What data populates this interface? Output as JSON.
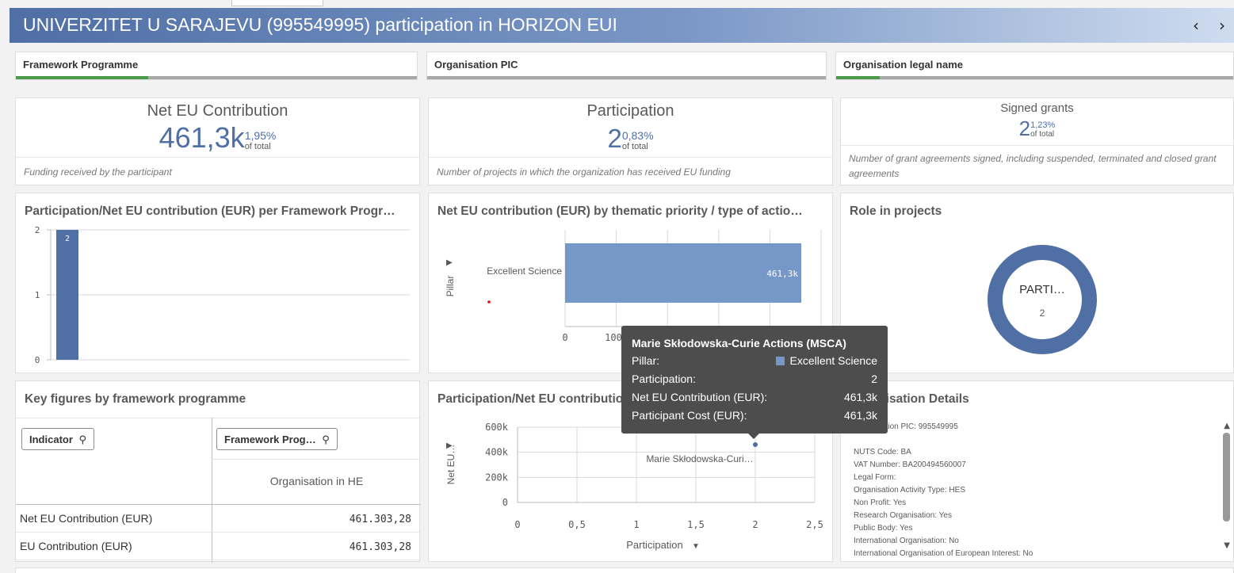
{
  "header": {
    "title": "UNIVERZITET U SARAJEVU (995549995) participation in HORIZON EUI",
    "prev_icon": "chevron-left-icon",
    "next_icon": "chevron-right-icon"
  },
  "filters": [
    {
      "label": "Framework Programme",
      "selected_fraction": 0.33
    },
    {
      "label": "Organisation PIC",
      "selected_fraction": 0
    },
    {
      "label": "Organisation legal name",
      "selected_fraction": 0.11
    }
  ],
  "kpis": {
    "net_eu": {
      "title": "Net EU Contribution",
      "value": "461,3k",
      "pct": "1,95%",
      "of_total": "of total",
      "footer": "Funding received by the participant"
    },
    "participation": {
      "title": "Participation",
      "value": "2",
      "pct": "0,83%",
      "of_total": "of total",
      "footer": "Number of projects in which the organization has received EU funding"
    },
    "signed": {
      "title": "Signed grants",
      "value": "2",
      "pct": "1,23%",
      "of_total": "of total",
      "footer": "Number of grant agreements signed, including suspended, terminated and closed grant agreements"
    }
  },
  "charts": {
    "fp_bar": {
      "title": "Participation/Net EU contribution (EUR) per Framework Progr…"
    },
    "thematic": {
      "title": "Net EU contribution (EUR) by thematic priority / type of actio…",
      "y_axis_label": "Pillar"
    },
    "role": {
      "title": "Role in projects",
      "center_label": "PARTI…",
      "center_value": "2"
    },
    "scatter": {
      "title": "Participation/Net EU contribution (EUR) by t…",
      "point_label": "Marie Skłodowska-Curi…",
      "y_axis_label": "Net EU…",
      "x_axis_label": "Participation",
      "sort_icon": "caret-down-icon"
    }
  },
  "chart_data": [
    {
      "type": "bar",
      "categories": [
        ""
      ],
      "values": [
        2
      ],
      "data_labels": [
        "2"
      ],
      "ylim": [
        0,
        2
      ],
      "yticks": [
        "0",
        "1",
        "2"
      ]
    },
    {
      "type": "bar",
      "orientation": "horizontal",
      "categories": [
        "Excellent Science"
      ],
      "values": [
        461303.28
      ],
      "data_labels": [
        "461,3k"
      ],
      "xticks": [
        "0",
        "100k"
      ],
      "xlabel": "Net EU Contribution (EUR)",
      "ylabel": "Pillar"
    },
    {
      "type": "pie",
      "donut": true,
      "slices": [
        {
          "label": "PARTI…",
          "value": 2
        }
      ]
    },
    {
      "type": "scatter",
      "points": [
        {
          "x": 2,
          "y": 461303.28,
          "label": "Marie Skłodowska-Curi…"
        }
      ],
      "xlim": [
        0,
        2.5
      ],
      "ylim": [
        0,
        600000
      ],
      "xticks": [
        "0",
        "0,5",
        "1",
        "1,5",
        "2",
        "2,5"
      ],
      "yticks": [
        "0",
        "200k",
        "400k",
        "600k"
      ],
      "xlabel": "Participation",
      "ylabel": "Net EU…"
    }
  ],
  "table": {
    "title": "Key figures by framework programme",
    "indicator_btn": "Indicator",
    "fp_btn": "Framework Prog…",
    "column_header": "Organisation in HE",
    "rows": [
      {
        "label": "Net EU Contribution (EUR)",
        "value": "461.303,28"
      },
      {
        "label": "EU Contribution (EUR)",
        "value": "461.303,28"
      }
    ]
  },
  "details": {
    "title": "Organisation Details",
    "lines": [
      "Organisation PIC: 995549995",
      "",
      "NUTS Code: BA",
      "VAT Number: BA200494560007",
      "Legal Form:",
      "Organisation Activity Type: HES",
      "Non Profit: Yes",
      "Research Organisation: Yes",
      "Public Body: Yes",
      "International Organisation: No",
      "International Organisation of European Interest: No"
    ]
  },
  "tooltip": {
    "title": "Marie Skłodowska-Curie Actions (MSCA)",
    "rows": [
      {
        "key": "Pillar:",
        "value": "Excellent Science",
        "swatch": "#7598c8"
      },
      {
        "key": "Participation:",
        "value": "2"
      },
      {
        "key": "Net EU Contribution (EUR):",
        "value": "461,3k"
      },
      {
        "key": "Participant Cost (EUR):",
        "value": "461,3k"
      }
    ]
  },
  "colors": {
    "accent": "#4f6fa5",
    "bar": "#7598c8",
    "filter_selected": "#4a9a4a"
  }
}
